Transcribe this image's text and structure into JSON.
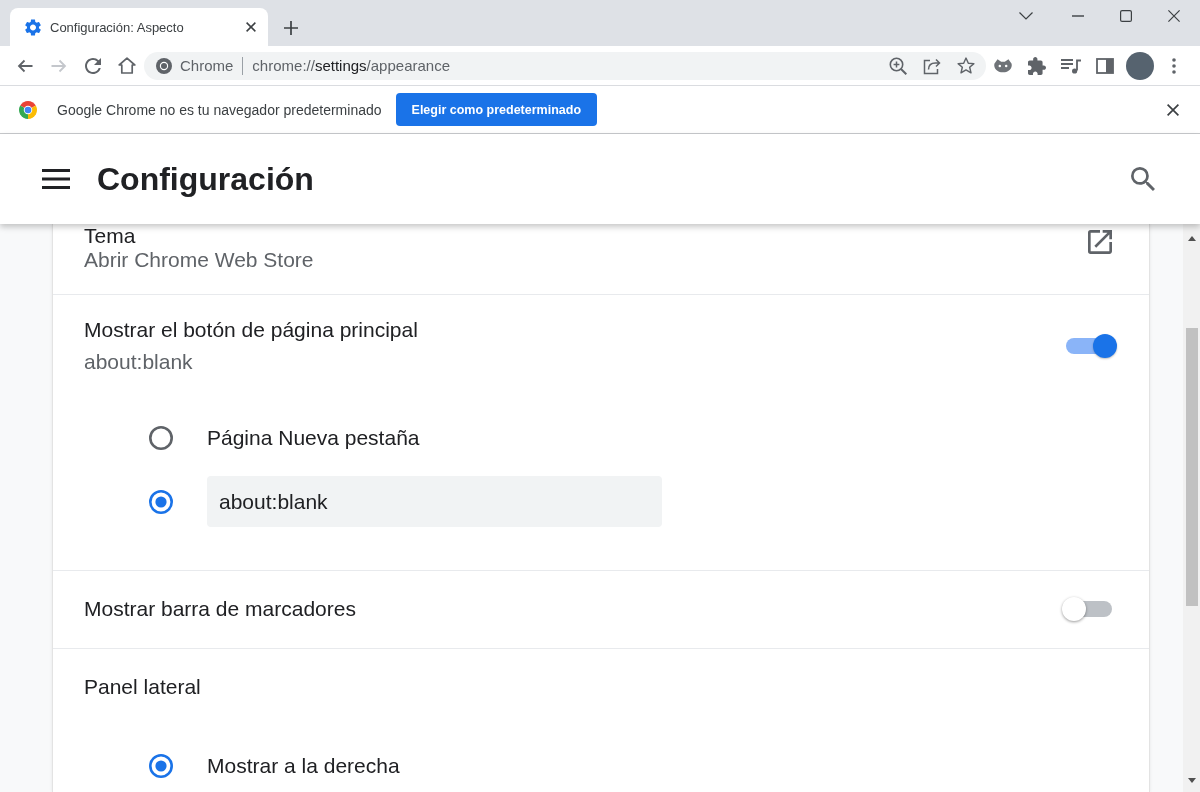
{
  "tabs": [
    {
      "title": "Configuración: Aspecto",
      "selected": true
    }
  ],
  "navigation": {
    "back_disabled": false,
    "forward_disabled": true
  },
  "omnibox": {
    "site_label": "Chrome",
    "url": {
      "scheme": "chrome://",
      "host": "settings",
      "path": "/appearance"
    }
  },
  "infobar": {
    "message": "Google Chrome no es tu navegador predeterminado",
    "button": "Elegir como predeterminado"
  },
  "header": {
    "title": "Configuración"
  },
  "sections": [
    {
      "kind": "link",
      "title": "Tema",
      "subtitle": "Abrir Chrome Web Store"
    },
    {
      "kind": "toggle",
      "title": "Mostrar el botón de página principal",
      "subtitle": "about:blank",
      "on": true,
      "options": [
        {
          "kind": "label",
          "label": "Página Nueva pestaña",
          "selected": false
        },
        {
          "kind": "input",
          "value": "about:blank",
          "selected": true
        }
      ]
    },
    {
      "kind": "toggle",
      "title": "Mostrar barra de marcadores",
      "on": false
    },
    {
      "kind": "heading",
      "title": "Panel lateral",
      "options": [
        {
          "kind": "label",
          "label": "Mostrar a la derecha",
          "selected": true
        }
      ]
    }
  ]
}
